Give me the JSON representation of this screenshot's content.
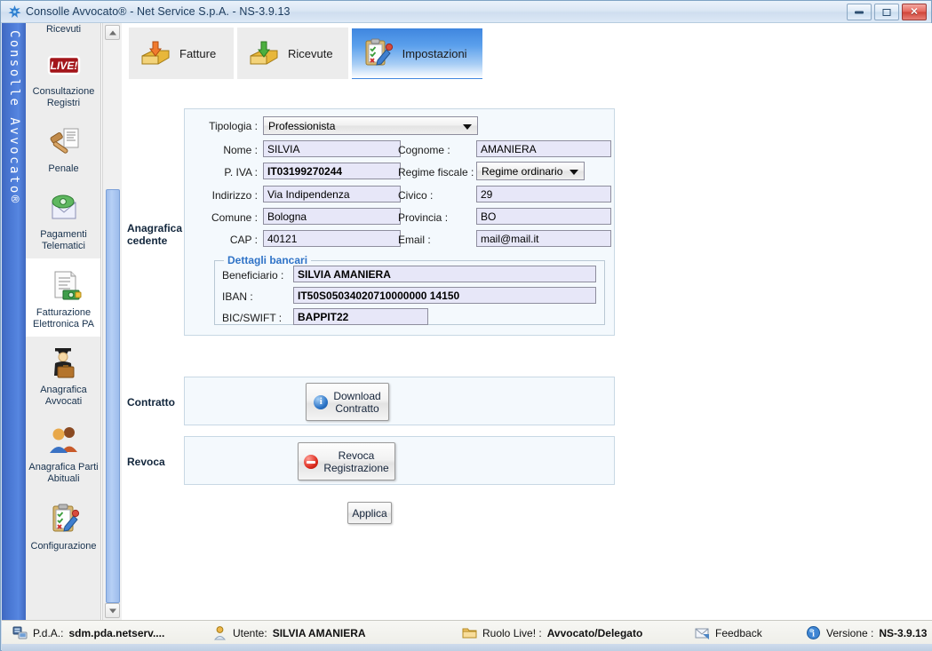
{
  "window": {
    "title": "Consolle Avvocato® - Net Service S.p.A. - NS-3.9.13",
    "icon": "app-icon",
    "minimize_label": "",
    "maximize_label": "",
    "close_label": "✕"
  },
  "brand": {
    "vertical_text": "Consolle Avvocato®",
    "color": "#4a78d4"
  },
  "sidebar": {
    "partial_top_label": "Ricevuti",
    "items": [
      {
        "label": "Consultazione Registri",
        "icon": "live-badge-icon",
        "selected": false
      },
      {
        "label": "Penale",
        "icon": "gavel-document-icon",
        "selected": false
      },
      {
        "label": "Pagamenti Telematici",
        "icon": "money-envelope-icon",
        "selected": false
      },
      {
        "label": "Fatturazione Elettronica PA",
        "icon": "invoice-money-icon",
        "selected": true
      },
      {
        "label": "Anagrafica Avvocati",
        "icon": "lawyer-briefcase-icon",
        "selected": false
      },
      {
        "label": "Anagrafica Parti Abituali",
        "icon": "two-people-icon",
        "selected": false
      },
      {
        "label": "Configurazione",
        "icon": "clipboard-pencil-icon",
        "selected": false
      }
    ],
    "scrollbar": {
      "up": "▲",
      "down": "▼"
    }
  },
  "tabs": [
    {
      "label": "Fatture",
      "icon": "tray-up-arrow-icon",
      "active": false
    },
    {
      "label": "Ricevute",
      "icon": "tray-down-arrow-icon",
      "active": false
    },
    {
      "label": "Impostazioni",
      "icon": "clipboard-pencil-icon",
      "active": true
    }
  ],
  "sections": {
    "anagrafica": {
      "row_label_line1": "Anagrafica",
      "row_label_line2": "cedente",
      "fields": {
        "tipologia_label": "Tipologia :",
        "tipologia_value": "Professionista",
        "nome_label": "Nome :",
        "nome_value": "SILVIA",
        "cognome_label": "Cognome :",
        "cognome_value": "AMANIERA",
        "piva_label": "P. IVA :",
        "piva_value": "IT03199270244",
        "regime_label": "Regime fiscale :",
        "regime_value": "Regime ordinario",
        "indirizzo_label": "Indirizzo :",
        "indirizzo_value": "Via Indipendenza",
        "civico_label": "Civico :",
        "civico_value": "29",
        "comune_label": "Comune :",
        "comune_value": "Bologna",
        "provincia_label": "Provincia :",
        "provincia_value": "BO",
        "cap_label": "CAP :",
        "cap_value": "40121",
        "email_label": "Email :",
        "email_value": "mail@mail.it"
      },
      "bank": {
        "legend": "Dettagli bancari",
        "beneficiario_label": "Beneficiario :",
        "beneficiario_value": "SILVIA AMANIERA",
        "iban_label": "IBAN :",
        "iban_value": "IT50S05034020710000000 14150",
        "bic_label": "BIC/SWIFT :",
        "bic_value": "BAPPIT22"
      }
    },
    "contratto": {
      "row_label": "Contratto",
      "button_line1": "Download",
      "button_line2": "Contratto",
      "button_icon": "info-circle-icon"
    },
    "revoca": {
      "row_label": "Revoca",
      "button_line1": "Revoca",
      "button_line2": "Registrazione",
      "button_icon": "minus-circle-icon"
    },
    "apply": {
      "label": "Applica"
    }
  },
  "statusbar": {
    "pda_label": "P.d.A.:",
    "pda_value": "sdm.pda.netserv....",
    "pda_icon": "server-icon",
    "utente_label": "Utente:",
    "utente_value": "SILVIA AMANIERA",
    "utente_icon": "user-icon",
    "ruolo_label": "Ruolo Live! :",
    "ruolo_value": "Avvocato/Delegato",
    "ruolo_icon": "folder-icon",
    "feedback_label": "Feedback",
    "feedback_icon": "mail-icon",
    "versione_label": "Versione :",
    "versione_value": "NS-3.9.13",
    "versione_icon": "info-circle-icon"
  },
  "colors": {
    "accent_blue": "#4a78d4",
    "tab_active": "#3f86df",
    "field_bg": "#e7e7f8",
    "legend_blue": "#2f73c7",
    "panel_bg": "#f4f9fd"
  }
}
